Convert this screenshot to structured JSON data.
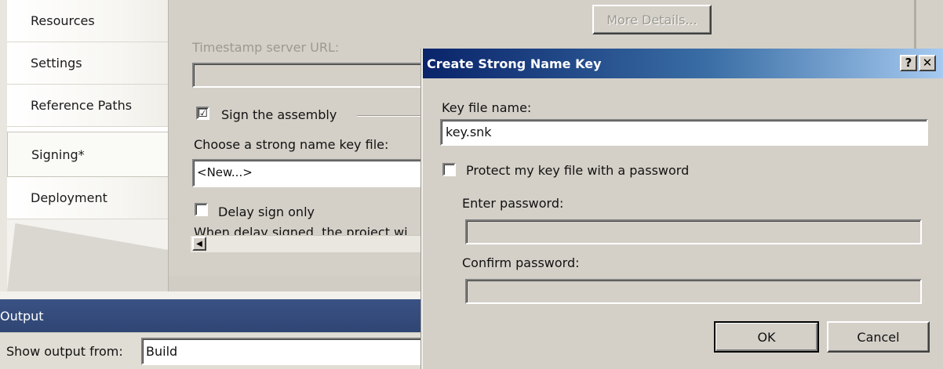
{
  "nav": {
    "items": [
      {
        "label": "Resources"
      },
      {
        "label": "Settings"
      },
      {
        "label": "Reference Paths"
      },
      {
        "label": "Signing*"
      },
      {
        "label": "Deployment"
      }
    ]
  },
  "signing": {
    "more_details_label": "More Details...",
    "timestamp_label": "Timestamp server URL:",
    "timestamp_value": "",
    "sign_assembly_label": "Sign the assembly",
    "sign_assembly_checked": "☑",
    "choose_key_label": "Choose a strong name key file:",
    "key_file_selected": "<New...>",
    "delay_sign_label": "Delay sign only",
    "delay_sign_note": "When delay signed, the project wi",
    "scroll_left_glyph": "◀"
  },
  "output": {
    "title": "Output",
    "show_from_label": "Show output from:",
    "show_from_value": "Build"
  },
  "dialog": {
    "title": "Create Strong Name Key",
    "help_glyph": "?",
    "close_glyph": "✕",
    "key_file_name_label": "Key file name:",
    "key_file_name_value": "key.snk",
    "protect_label": "Protect my key file with a password",
    "enter_password_label": "Enter password:",
    "confirm_password_label": "Confirm password:",
    "ok_label": "OK",
    "cancel_label": "Cancel"
  }
}
